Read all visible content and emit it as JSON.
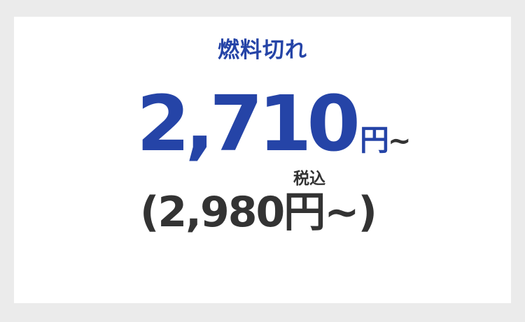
{
  "service": {
    "title": "燃料切れ"
  },
  "price": {
    "amount": "2,710",
    "unit": "円",
    "tilde": "~"
  },
  "tax_price": {
    "open_paren": "(",
    "amount": "2,980",
    "unit": "円",
    "tilde": "~",
    "close_paren": ")",
    "label": "税込"
  },
  "colors": {
    "accent": "#2544a7",
    "text": "#333333",
    "background": "#ebebeb",
    "card": "#ffffff"
  }
}
